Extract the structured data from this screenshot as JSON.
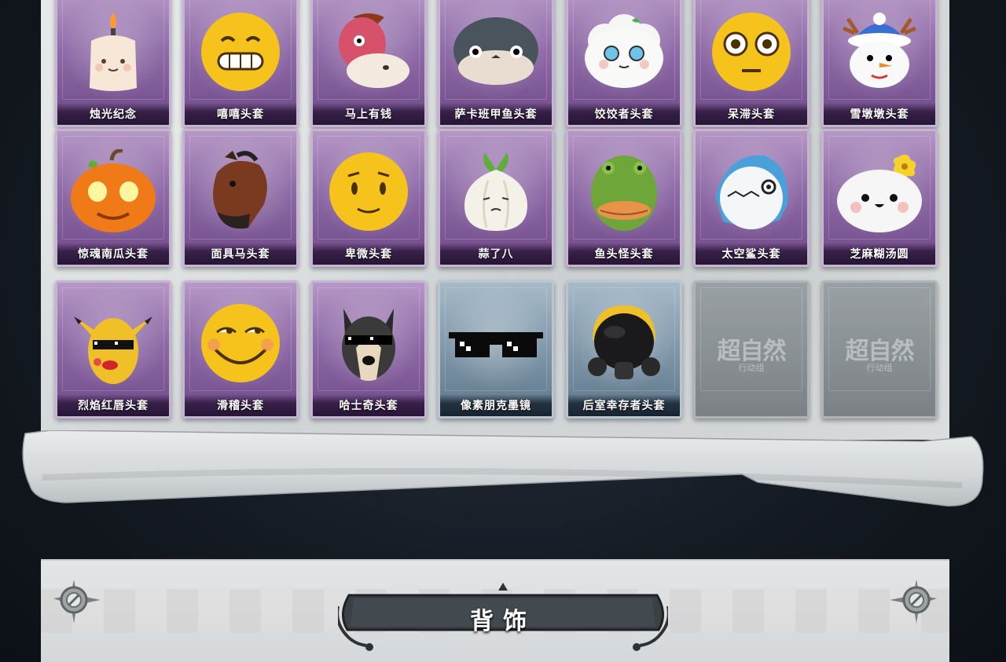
{
  "section_title": "背饰",
  "placeholder": {
    "logo_text": "超自然",
    "logo_sub": "行动组"
  },
  "rows": [
    {
      "items": [
        {
          "label": "烛光纪念",
          "rarity": "purple",
          "icon": "candle-head-icon"
        },
        {
          "label": "嘻嘻头套",
          "rarity": "purple",
          "icon": "grin-emoji-icon"
        },
        {
          "label": "马上有钱",
          "rarity": "purple",
          "icon": "pink-horse-icon"
        },
        {
          "label": "萨卡班甲鱼头套",
          "rarity": "purple",
          "icon": "fish-head-icon"
        },
        {
          "label": "饺饺者头套",
          "rarity": "purple",
          "icon": "dumpling-head-icon"
        },
        {
          "label": "呆滞头套",
          "rarity": "purple",
          "icon": "stare-emoji-icon"
        },
        {
          "label": "雪墩墩头套",
          "rarity": "purple",
          "icon": "snowman-head-icon"
        }
      ]
    },
    {
      "items": [
        {
          "label": "惊魂南瓜头套",
          "rarity": "purple",
          "icon": "pumpkin-head-icon"
        },
        {
          "label": "面具马头套",
          "rarity": "purple",
          "icon": "horse-mask-icon"
        },
        {
          "label": "卑微头套",
          "rarity": "purple",
          "icon": "humble-emoji-icon"
        },
        {
          "label": "蒜了八",
          "rarity": "purple",
          "icon": "garlic-head-icon"
        },
        {
          "label": "鱼头怪头套",
          "rarity": "purple",
          "icon": "fishman-head-icon"
        },
        {
          "label": "太空鲨头套",
          "rarity": "purple",
          "icon": "shark-head-icon"
        },
        {
          "label": "芝麻糊汤圆",
          "rarity": "purple",
          "icon": "tangyuan-head-icon"
        }
      ]
    },
    {
      "items": [
        {
          "label": "烈焰红唇头套",
          "rarity": "purple",
          "icon": "yellow-mouse-head-icon"
        },
        {
          "label": "滑稽头套",
          "rarity": "purple",
          "icon": "funny-emoji-icon"
        },
        {
          "label": "哈士奇头套",
          "rarity": "purple",
          "icon": "husky-head-icon"
        },
        {
          "label": "像素朋克墨镜",
          "rarity": "blue",
          "icon": "pixel-sunglasses-icon"
        },
        {
          "label": "后室幸存者头套",
          "rarity": "blue",
          "icon": "gas-mask-helmet-icon"
        },
        {
          "label": "",
          "rarity": "gray",
          "icon": "locked-placeholder-icon"
        },
        {
          "label": "",
          "rarity": "gray",
          "icon": "locked-placeholder-icon"
        }
      ]
    }
  ],
  "colors": {
    "purple_card": "#8e6aa6",
    "blue_card": "#7f97a9",
    "gray_card": "#8a9194",
    "stone": "#d8dbdc"
  }
}
